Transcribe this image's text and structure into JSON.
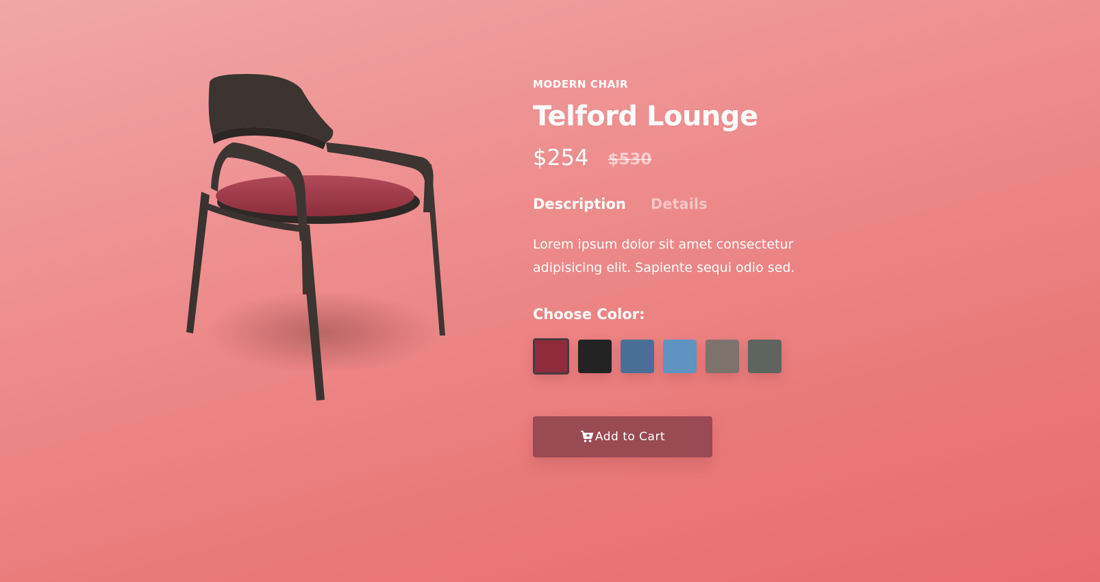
{
  "product": {
    "category": "MODERN CHAIR",
    "title": "Telford Lounge",
    "price": "$254",
    "old_price": "$530",
    "image_alt": "modern lounge chair with red cushion"
  },
  "tabs": [
    {
      "label": "Description",
      "active": true
    },
    {
      "label": "Details",
      "active": false
    }
  ],
  "description": "Lorem ipsum dolor sit amet consectetur adipisicing elit. Sapiente sequi odio sed.",
  "color_picker": {
    "label": "Choose Color:",
    "selected_index": 0,
    "swatches": [
      {
        "name": "red",
        "color": "#8e2c3c"
      },
      {
        "name": "black",
        "color": "#232323"
      },
      {
        "name": "blue-velvet",
        "color": "#4a6f96"
      },
      {
        "name": "light-blue",
        "color": "#5f93c2"
      },
      {
        "name": "taupe",
        "color": "#7d726c"
      },
      {
        "name": "grey",
        "color": "#5e6460"
      }
    ]
  },
  "cart_button": {
    "label": "Add to Cart",
    "icon": "cart-plus-icon"
  },
  "colors": {
    "background_top": "#f0a7a6",
    "background_bottom": "#e86c6e",
    "button": "#994a53",
    "text": "#ffffff"
  }
}
